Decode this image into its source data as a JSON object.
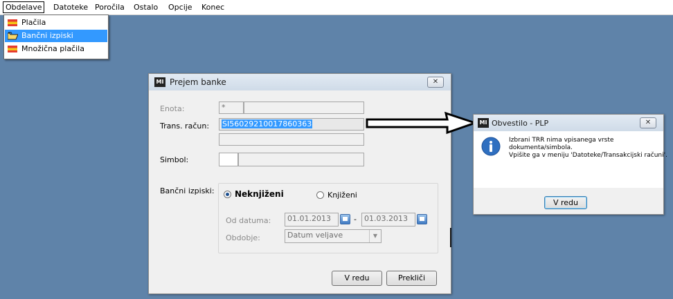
{
  "menubar": {
    "items": [
      {
        "label": "Obdelave"
      },
      {
        "label": "Datoteke"
      },
      {
        "label": "Poročila"
      },
      {
        "label": "Ostalo"
      },
      {
        "label": "Opcije"
      },
      {
        "label": "Konec"
      }
    ]
  },
  "dropdown": {
    "items": [
      {
        "label": "Plačila",
        "icon": "flag-icon"
      },
      {
        "label": "Bančni izpiski",
        "icon": "open-folder-icon"
      },
      {
        "label": "Množična plačila",
        "icon": "flag-icon"
      }
    ],
    "selected": "Bančni izpiski"
  },
  "dialog": {
    "title": "Prejem banke",
    "enota_label": "Enota:",
    "enota_code": "*",
    "enota_name": "",
    "trans_label": "Trans. račun:",
    "trans_value": "SI56029210017860363",
    "trans_extra": "",
    "simbol_label": "Simbol:",
    "simbol_code": "",
    "simbol_name": "",
    "izpiski_label": "Bančni izpiski:",
    "radio_neknjizeni": "Neknjiženi",
    "radio_knjizeni": "Knjiženi",
    "selected_radio": "Neknjiženi",
    "od_label": "Od datuma:",
    "date_from": "01.01.2013",
    "date_sep": "-",
    "date_to": "01.03.2013",
    "obdobje_label": "Obdobje:",
    "obdobje_value": "Datum veljave",
    "ok_label": "V redu",
    "cancel_label": "Prekliči",
    "close_glyph": "✕"
  },
  "message": {
    "title": "Obvestilo - PLP",
    "line1": "Izbrani TRR nima vpisanega vrste",
    "line2": "dokumenta/simbola.",
    "line3": "Vpišite ga v meniju 'Datoteke/Transakcijski računi'.",
    "ok_label": "V redu",
    "close_glyph": "✕",
    "icon": "info-icon"
  },
  "colors": {
    "desktop": "#5f83a9",
    "selection": "#3399ff"
  }
}
